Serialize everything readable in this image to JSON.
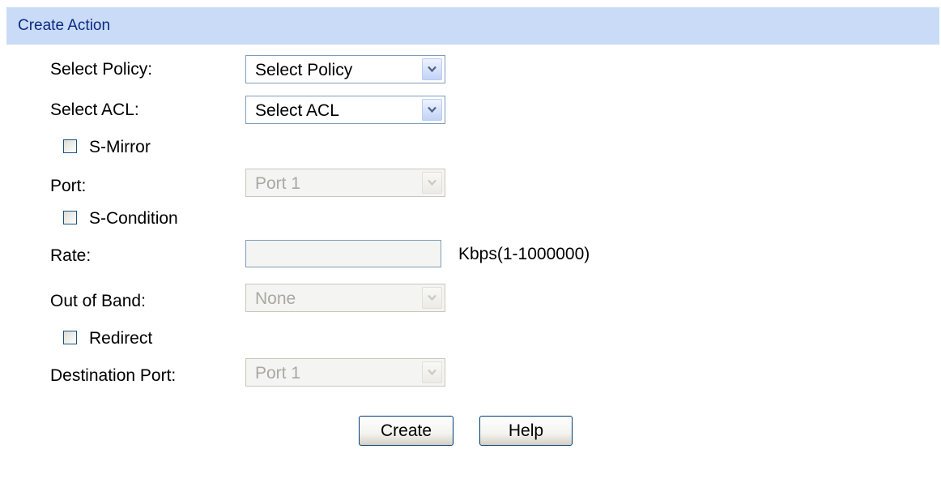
{
  "header": {
    "title": "Create Action"
  },
  "form": {
    "policy": {
      "label": "Select Policy:",
      "value": "Select Policy"
    },
    "acl": {
      "label": "Select ACL:",
      "value": "Select ACL"
    },
    "s_mirror": {
      "label": "S-Mirror",
      "checked": false
    },
    "mirror_port": {
      "label": "Port:",
      "value": "Port 1",
      "disabled": true
    },
    "s_condition": {
      "label": "S-Condition",
      "checked": false
    },
    "rate": {
      "label": "Rate:",
      "value": "",
      "hint": "Kbps(1-1000000)"
    },
    "out_of_band": {
      "label": "Out of Band:",
      "value": "None",
      "disabled": true
    },
    "redirect": {
      "label": "Redirect",
      "checked": false
    },
    "destination_port": {
      "label": "Destination Port:",
      "value": "Port 1",
      "disabled": true
    }
  },
  "buttons": {
    "create": "Create",
    "help": "Help"
  },
  "colors": {
    "header_bg": "#c9dbf7",
    "header_text": "#0b2a80",
    "field_border": "#7f9db9",
    "disabled_text": "#a9a8a2"
  },
  "icons": {
    "dropdown_arrow": "chevron-down-icon"
  }
}
